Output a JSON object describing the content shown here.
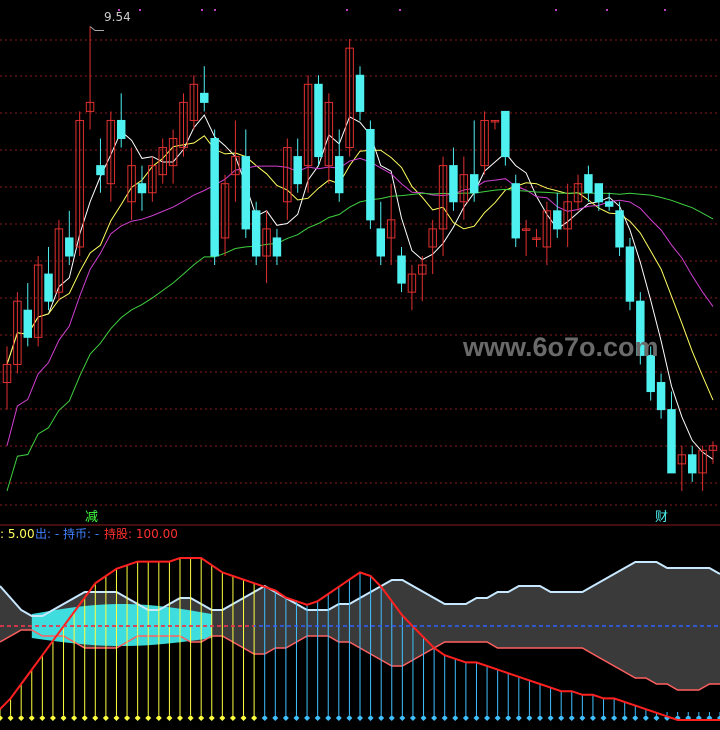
{
  "chart_data": [
    {
      "type": "candlestick",
      "price_label": "9.54",
      "marker_left": "减",
      "marker_right": "财",
      "watermark": "www.6o7o.com",
      "colors": {
        "up": "#e03030",
        "down": "#4ef0f0",
        "ma5": "#ffffff",
        "ma10": "#ffff60",
        "ma20": "#d040d0",
        "ma60": "#40d040",
        "grid": "#8a1a1a"
      },
      "candles": [
        [
          5.6,
          6.0,
          5.3,
          5.8
        ],
        [
          5.8,
          6.6,
          5.7,
          6.5
        ],
        [
          6.4,
          6.7,
          6.0,
          6.1
        ],
        [
          6.1,
          7.0,
          6.0,
          6.9
        ],
        [
          6.8,
          7.1,
          6.4,
          6.5
        ],
        [
          6.6,
          7.4,
          6.5,
          7.3
        ],
        [
          7.2,
          7.5,
          6.9,
          7.0
        ],
        [
          7.1,
          8.6,
          7.0,
          8.5
        ],
        [
          8.6,
          9.54,
          8.4,
          8.7
        ],
        [
          8.0,
          8.3,
          7.7,
          7.9
        ],
        [
          7.8,
          8.6,
          7.6,
          8.5
        ],
        [
          8.5,
          8.8,
          8.2,
          8.3
        ],
        [
          7.6,
          8.2,
          7.4,
          8.0
        ],
        [
          7.8,
          8.0,
          7.5,
          7.7
        ],
        [
          7.7,
          8.1,
          7.6,
          8.0
        ],
        [
          7.9,
          8.3,
          7.8,
          8.2
        ],
        [
          8.0,
          8.4,
          7.8,
          8.3
        ],
        [
          8.2,
          8.8,
          8.1,
          8.7
        ],
        [
          8.5,
          9.0,
          8.4,
          8.9
        ],
        [
          8.8,
          9.1,
          8.6,
          8.7
        ],
        [
          8.3,
          8.4,
          6.9,
          7.0
        ],
        [
          7.2,
          7.9,
          7.0,
          7.8
        ],
        [
          7.9,
          8.5,
          7.6,
          8.1
        ],
        [
          8.1,
          8.4,
          7.2,
          7.3
        ],
        [
          7.5,
          7.6,
          6.9,
          7.0
        ],
        [
          7.0,
          7.5,
          6.7,
          7.3
        ],
        [
          7.2,
          7.3,
          6.9,
          7.0
        ],
        [
          7.6,
          8.3,
          7.4,
          8.2
        ],
        [
          8.1,
          8.3,
          7.7,
          7.8
        ],
        [
          8.0,
          9.0,
          7.7,
          8.9
        ],
        [
          8.9,
          9.0,
          8.0,
          8.1
        ],
        [
          8.0,
          8.8,
          7.8,
          8.7
        ],
        [
          8.1,
          8.4,
          7.6,
          7.7
        ],
        [
          8.2,
          9.4,
          8.1,
          9.3
        ],
        [
          9.0,
          9.1,
          8.5,
          8.6
        ],
        [
          8.4,
          8.5,
          7.3,
          7.4
        ],
        [
          7.3,
          7.6,
          6.9,
          7.0
        ],
        [
          7.2,
          7.8,
          6.9,
          7.4
        ],
        [
          7.0,
          7.1,
          6.6,
          6.7
        ],
        [
          6.6,
          6.9,
          6.4,
          6.8
        ],
        [
          6.8,
          7.0,
          6.5,
          6.9
        ],
        [
          7.1,
          7.4,
          6.8,
          7.3
        ],
        [
          7.3,
          8.1,
          7.0,
          8.0
        ],
        [
          8.0,
          8.2,
          7.5,
          7.6
        ],
        [
          7.6,
          8.1,
          7.4,
          7.9
        ],
        [
          7.9,
          8.5,
          7.6,
          7.7
        ],
        [
          8.0,
          8.6,
          7.9,
          8.5
        ],
        [
          8.5,
          8.5,
          8.4,
          8.5
        ],
        [
          8.6,
          8.6,
          8.0,
          8.1
        ],
        [
          7.8,
          7.9,
          7.1,
          7.2
        ],
        [
          7.3,
          7.4,
          7.0,
          7.3
        ],
        [
          7.2,
          7.3,
          7.1,
          7.2
        ],
        [
          7.1,
          7.6,
          6.9,
          7.5
        ],
        [
          7.5,
          7.7,
          7.2,
          7.3
        ],
        [
          7.3,
          7.8,
          7.1,
          7.6
        ],
        [
          7.6,
          7.9,
          7.5,
          7.8
        ],
        [
          7.9,
          8.0,
          7.6,
          7.7
        ],
        [
          7.8,
          7.8,
          7.5,
          7.6
        ],
        [
          7.6,
          7.7,
          7.5,
          7.55
        ],
        [
          7.5,
          7.6,
          7.0,
          7.1
        ],
        [
          7.1,
          7.2,
          6.4,
          6.5
        ],
        [
          6.5,
          6.6,
          5.8,
          5.9
        ],
        [
          5.9,
          6.0,
          5.4,
          5.5
        ],
        [
          5.6,
          5.7,
          5.2,
          5.3
        ],
        [
          5.3,
          5.5,
          4.6,
          4.6
        ],
        [
          4.7,
          4.9,
          4.4,
          4.8
        ],
        [
          4.8,
          4.9,
          4.5,
          4.6
        ],
        [
          4.6,
          4.9,
          4.4,
          4.85
        ],
        [
          4.85,
          4.95,
          4.7,
          4.9
        ]
      ]
    },
    {
      "type": "indicator",
      "legend": [
        {
          "text": ": 5.00",
          "color": "#ffff60"
        },
        {
          "text": "出: -",
          "color": "#4080ff"
        },
        {
          "text": "持币: -",
          "color": "#4080ff"
        },
        {
          "text": "持股: 100.00",
          "color": "#ff3030"
        }
      ],
      "red_line": [
        3,
        6,
        10,
        14,
        18,
        22,
        26,
        30,
        34,
        38,
        40,
        42,
        43,
        44,
        44,
        44,
        44,
        45,
        45,
        45,
        43,
        41,
        40,
        39,
        38,
        37,
        36,
        34,
        33,
        32,
        33,
        35,
        37,
        39,
        41,
        40,
        37,
        33,
        29,
        26,
        23,
        20,
        18,
        17,
        16,
        16,
        15,
        14,
        13,
        12,
        11,
        10,
        9,
        8,
        8,
        7,
        7,
        6,
        6,
        5,
        4,
        3,
        2,
        1,
        0,
        0,
        0,
        0,
        0
      ],
      "band_upper": [
        5,
        3,
        1,
        0,
        0,
        1,
        2,
        3,
        4,
        4,
        4,
        4,
        3,
        2,
        1,
        1,
        2,
        3,
        3,
        2,
        1,
        1,
        2,
        3,
        4,
        5,
        4,
        3,
        2,
        1,
        1,
        1,
        2,
        2,
        3,
        4,
        5,
        6,
        6,
        5,
        4,
        3,
        2,
        2,
        2,
        3,
        3,
        4,
        4,
        5,
        5,
        5,
        4,
        4,
        4,
        4,
        5,
        6,
        7,
        8,
        9,
        9,
        9,
        8,
        8,
        8,
        8,
        8,
        7
      ],
      "band_lower": [
        -2,
        -1,
        0,
        0,
        -1,
        -1,
        -1,
        -2,
        -3,
        -3,
        -3,
        -3,
        -2,
        -1,
        -1,
        -1,
        -1,
        -1,
        -2,
        -2,
        -1,
        -1,
        -2,
        -3,
        -4,
        -4,
        -3,
        -3,
        -2,
        -1,
        -1,
        -1,
        -2,
        -2,
        -3,
        -4,
        -5,
        -6,
        -6,
        -5,
        -4,
        -3,
        -2,
        -2,
        -2,
        -2,
        -2,
        -3,
        -3,
        -3,
        -3,
        -3,
        -3,
        -3,
        -3,
        -3,
        -4,
        -5,
        -6,
        -7,
        -8,
        -8,
        -9,
        -9,
        -10,
        -10,
        -10,
        -9,
        -9
      ],
      "marker_colors": [
        "#ffff40",
        "#40c0ff"
      ],
      "hold_until_index": 24
    }
  ]
}
